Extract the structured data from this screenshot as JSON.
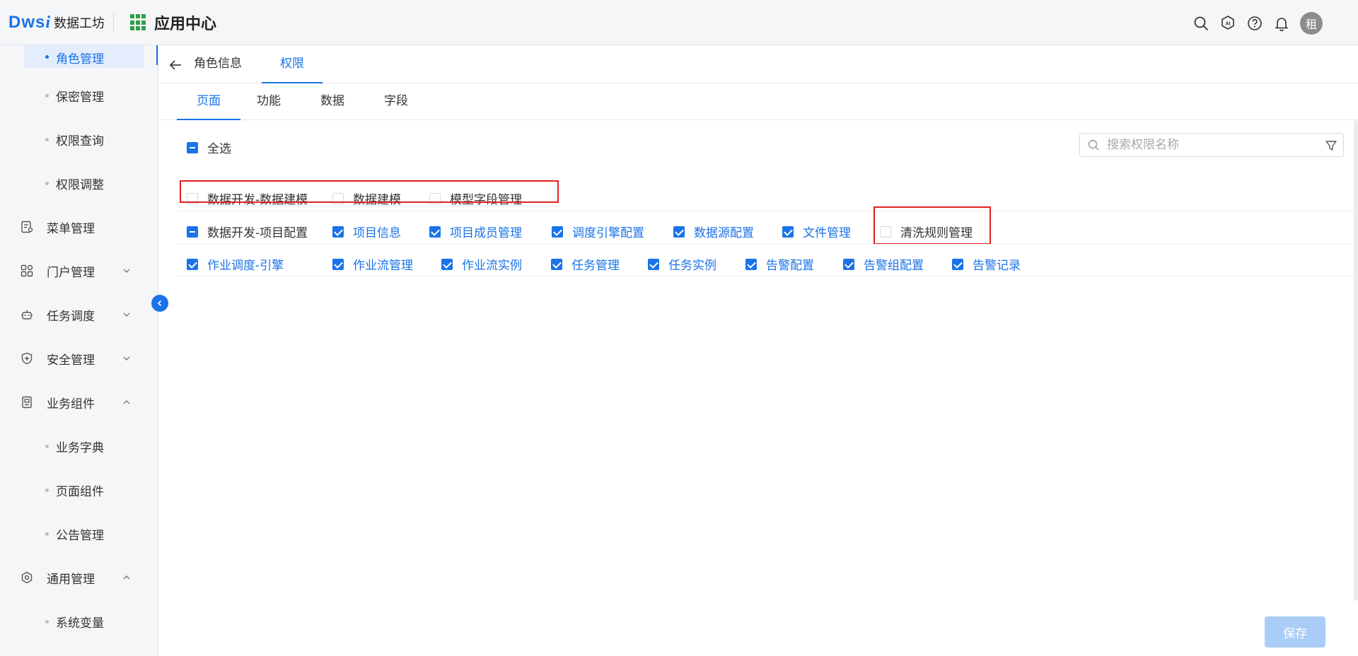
{
  "topbar": {
    "logo_mark": "Dws",
    "logo_i": "i",
    "logo_text": "数据工坊",
    "app_center": "应用中心",
    "avatar_text": "租",
    "accent": "#1a73e8"
  },
  "sidebar": {
    "items": [
      {
        "label": "角色管理",
        "type": "sub",
        "active": true
      },
      {
        "label": "保密管理",
        "type": "sub"
      },
      {
        "label": "权限查询",
        "type": "sub"
      },
      {
        "label": "权限调整",
        "type": "sub"
      },
      {
        "label": "菜单管理",
        "type": "group",
        "icon": "menu-doc-icon"
      },
      {
        "label": "门户管理",
        "type": "group",
        "icon": "portal-grid-icon",
        "chevron": "down"
      },
      {
        "label": "任务调度",
        "type": "group",
        "icon": "robot-icon",
        "chevron": "down"
      },
      {
        "label": "安全管理",
        "type": "group",
        "icon": "shield-icon",
        "chevron": "down"
      },
      {
        "label": "业务组件",
        "type": "group",
        "icon": "component-icon",
        "chevron": "up"
      },
      {
        "label": "业务字典",
        "type": "sub"
      },
      {
        "label": "页面组件",
        "type": "sub"
      },
      {
        "label": "公告管理",
        "type": "sub"
      },
      {
        "label": "通用管理",
        "type": "group",
        "icon": "settings-icon",
        "chevron": "up"
      },
      {
        "label": "系统变量",
        "type": "sub"
      }
    ]
  },
  "header_tabs": [
    {
      "label": "角色信息",
      "active": false
    },
    {
      "label": "权限",
      "active": true
    }
  ],
  "sub_tabs": [
    {
      "label": "页面",
      "active": true
    },
    {
      "label": "功能",
      "active": false
    },
    {
      "label": "数据",
      "active": false
    },
    {
      "label": "字段",
      "active": false
    }
  ],
  "select_all": {
    "label": "全选",
    "state": "indeterminate"
  },
  "search": {
    "placeholder": "搜索权限名称"
  },
  "rows": [
    [
      {
        "label": "数据开发-数据建模",
        "state": "unchecked"
      },
      {
        "label": "数据建模",
        "state": "unchecked"
      },
      {
        "label": "模型字段管理",
        "state": "unchecked"
      }
    ],
    [
      {
        "label": "数据开发-项目配置",
        "state": "indeterminate"
      },
      {
        "label": "项目信息",
        "state": "checked"
      },
      {
        "label": "项目成员管理",
        "state": "checked"
      },
      {
        "label": "调度引擎配置",
        "state": "checked"
      },
      {
        "label": "数据源配置",
        "state": "checked"
      },
      {
        "label": "文件管理",
        "state": "checked"
      },
      {
        "label": "清洗规则管理",
        "state": "unchecked"
      }
    ],
    [
      {
        "label": "作业调度-引擎",
        "state": "checked"
      },
      {
        "label": "作业流管理",
        "state": "checked"
      },
      {
        "label": "作业流实例",
        "state": "checked"
      },
      {
        "label": "任务管理",
        "state": "checked"
      },
      {
        "label": "任务实例",
        "state": "checked"
      },
      {
        "label": "告警配置",
        "state": "checked"
      },
      {
        "label": "告警组配置",
        "state": "checked"
      },
      {
        "label": "告警记录",
        "state": "checked"
      }
    ]
  ],
  "save_label": "保存"
}
